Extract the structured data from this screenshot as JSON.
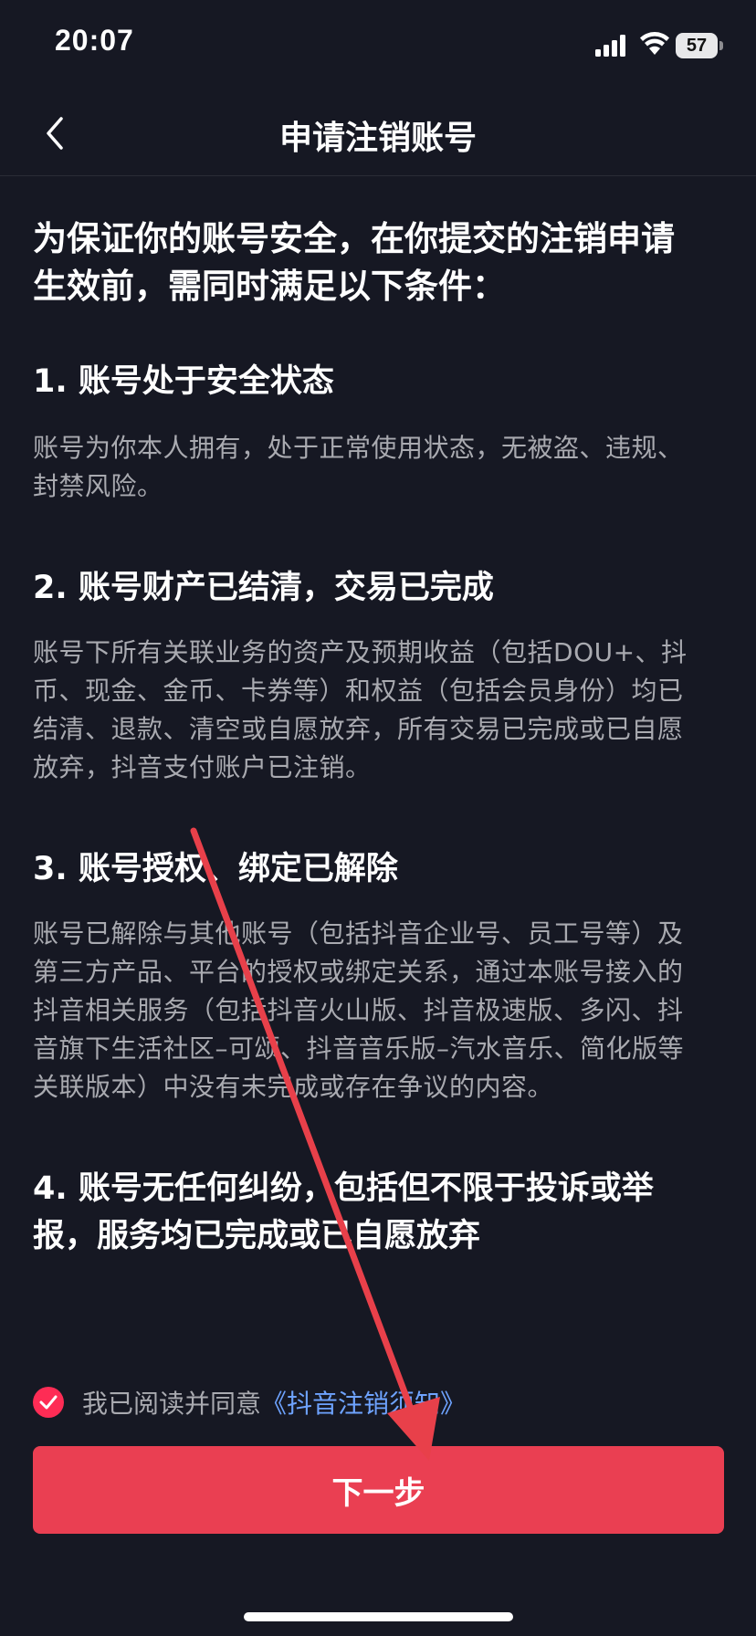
{
  "status_bar": {
    "time": "20:07",
    "battery": "57",
    "icons": [
      "signal-icon",
      "wifi-icon",
      "battery-icon"
    ]
  },
  "nav": {
    "title": "申请注销账号",
    "back_icon": "chevron-left-icon"
  },
  "intro": {
    "line1": "为保证你的账号安全，在你提交的注销申请",
    "line2": "生效前，需同时满足以下条件："
  },
  "sections": [
    {
      "title": "1. 账号处于安全状态",
      "body": [
        "账号为你本人拥有，处于正常使用状态，无被盗、违规、",
        "封禁风险。"
      ]
    },
    {
      "title": "2. 账号财产已结清，交易已完成",
      "body": [
        "账号下所有关联业务的资产及预期收益（包括DOU+、抖",
        "币、现金、金币、卡券等）和权益（包括会员身份）均已",
        "结清、退款、清空或自愿放弃，所有交易已完成或已自愿",
        "放弃，抖音支付账户已注销。"
      ]
    },
    {
      "title": "3. 账号授权、绑定已解除",
      "body": [
        "账号已解除与其他账号（包括抖音企业号、员工号等）及",
        "第三方产品、平台的授权或绑定关系，通过本账号接入的",
        "抖音相关服务（包括抖音火山版、抖音极速版、多闪、抖",
        "音旗下生活社区–可颂、抖音音乐版–汽水音乐、简化版等",
        "关联版本）中没有未完成或存在争议的内容。"
      ]
    },
    {
      "title_lines": [
        "4. 账号无任何纠纷，包括但不限于投诉或举",
        "报，服务均已完成或已自愿放弃"
      ]
    }
  ],
  "agreement": {
    "checked": true,
    "text": "我已阅读并同意",
    "link": "《抖音注销须知》"
  },
  "next_button": {
    "label": "下一步"
  },
  "colors": {
    "background": "#161823",
    "accent": "#ea3f52",
    "link": "#6ea3ff",
    "body_text": "#a9aab0",
    "annotation_arrow": "#e8404a"
  }
}
